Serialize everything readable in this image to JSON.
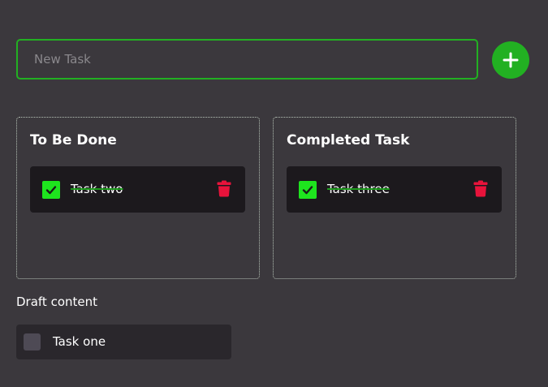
{
  "new_task": {
    "placeholder": "New Task",
    "value": ""
  },
  "add_button": {
    "icon": "plus-icon"
  },
  "panels": {
    "todo": {
      "title": "To Be Done",
      "tasks": [
        {
          "label": "Task two",
          "checked": true
        }
      ]
    },
    "completed": {
      "title": "Completed Task",
      "tasks": [
        {
          "label": "Task three",
          "checked": true
        }
      ]
    }
  },
  "draft": {
    "label": "Draft content",
    "items": [
      {
        "label": "Task one",
        "checked": false
      }
    ]
  },
  "colors": {
    "background": "#3b383d",
    "accent": "#22b022",
    "checkbox_checked": "#1ee41e",
    "delete": "#e8133b",
    "card": "#1c191d",
    "draft_card": "#2a272c"
  }
}
